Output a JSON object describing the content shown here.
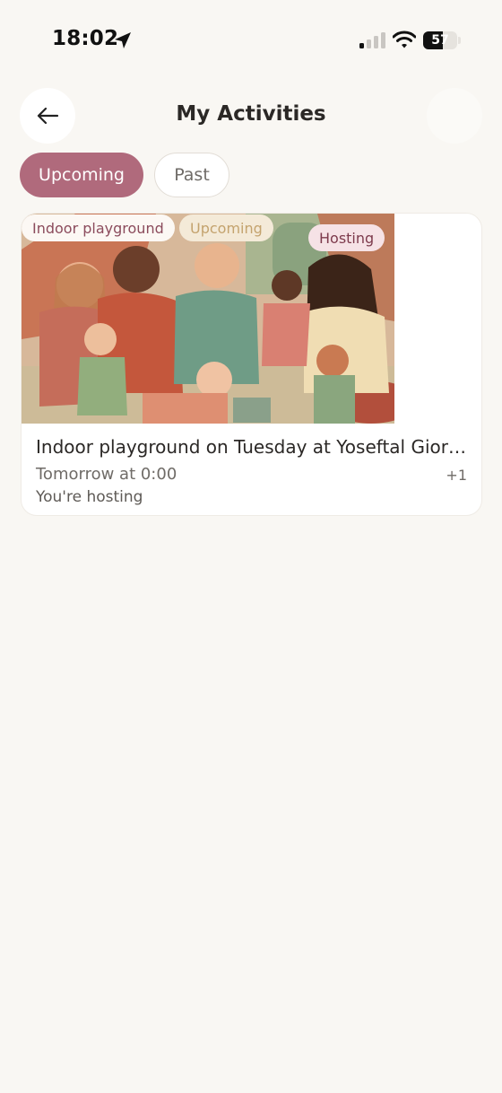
{
  "status_bar": {
    "time": "18:02",
    "battery": "57",
    "battery_level": 0.57
  },
  "header": {
    "title": "My Activities",
    "back_icon": "arrow-left-icon"
  },
  "tabs": [
    {
      "label": "Upcoming",
      "active": true
    },
    {
      "label": "Past",
      "active": false
    }
  ],
  "activities": [
    {
      "type_chip": "Indoor playground",
      "status_chip": "Upcoming",
      "hosting_chip": "Hosting",
      "title": "Indoor playground on Tuesday at Yoseftal Giora...",
      "time": "Tomorrow at 0:00",
      "extra_count": "+1",
      "host_note": "You're hosting"
    }
  ],
  "colors": {
    "accent": "#b06a7c",
    "background": "#f9f7f3"
  }
}
